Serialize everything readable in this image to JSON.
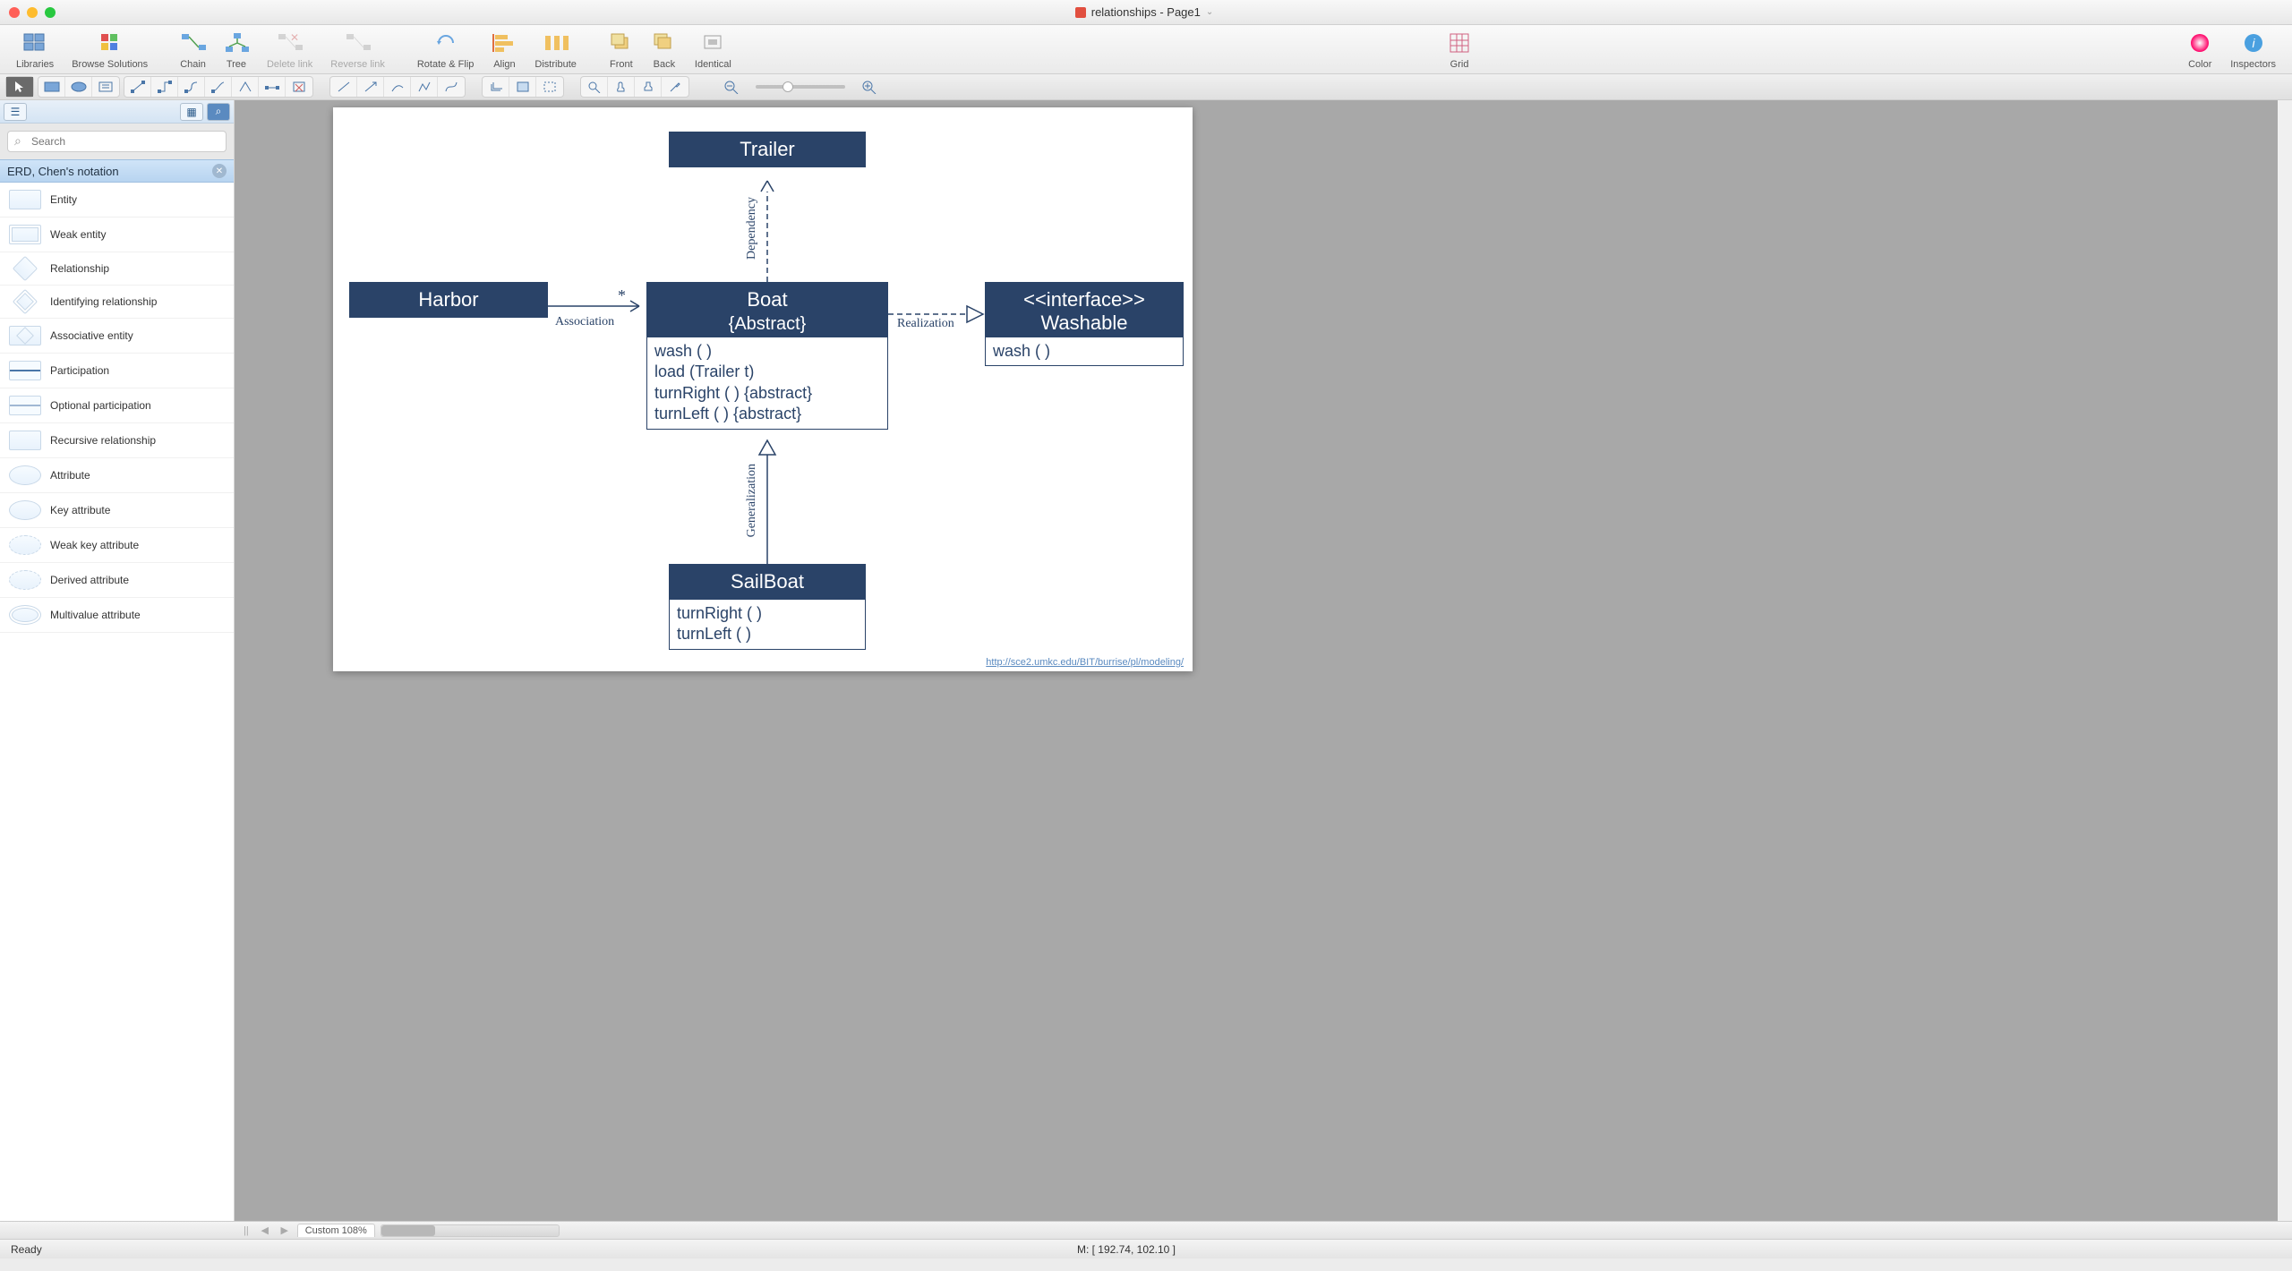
{
  "window": {
    "title": "relationships - Page1"
  },
  "toolbar": {
    "items": [
      {
        "label": "Libraries",
        "id": "libraries"
      },
      {
        "label": "Browse Solutions",
        "id": "browse-solutions"
      },
      {
        "label": "Chain",
        "id": "chain"
      },
      {
        "label": "Tree",
        "id": "tree"
      },
      {
        "label": "Delete link",
        "id": "delete-link",
        "disabled": true
      },
      {
        "label": "Reverse link",
        "id": "reverse-link",
        "disabled": true
      },
      {
        "label": "Rotate & Flip",
        "id": "rotate-flip"
      },
      {
        "label": "Align",
        "id": "align"
      },
      {
        "label": "Distribute",
        "id": "distribute"
      },
      {
        "label": "Front",
        "id": "front"
      },
      {
        "label": "Back",
        "id": "back"
      },
      {
        "label": "Identical",
        "id": "identical"
      },
      {
        "label": "Grid",
        "id": "grid"
      },
      {
        "label": "Color",
        "id": "color"
      },
      {
        "label": "Inspectors",
        "id": "inspectors"
      }
    ]
  },
  "sidebar": {
    "search_placeholder": "Search",
    "section_title": "ERD, Chen's notation",
    "items": [
      {
        "label": "Entity"
      },
      {
        "label": "Weak entity"
      },
      {
        "label": "Relationship"
      },
      {
        "label": "Identifying relationship"
      },
      {
        "label": "Associative entity"
      },
      {
        "label": "Participation"
      },
      {
        "label": "Optional participation"
      },
      {
        "label": "Recursive relationship"
      },
      {
        "label": "Attribute"
      },
      {
        "label": "Key attribute"
      },
      {
        "label": "Weak key attribute"
      },
      {
        "label": "Derived attribute"
      },
      {
        "label": "Multivalue attribute"
      }
    ]
  },
  "diagram": {
    "trailer": {
      "title": "Trailer"
    },
    "harbor": {
      "title": "Harbor"
    },
    "boat": {
      "title": "Boat",
      "subtitle": "{Abstract}",
      "methods": [
        "wash ( )",
        "load (Trailer t)",
        "turnRight ( ) {abstract}",
        "turnLeft ( ) {abstract}"
      ]
    },
    "washable": {
      "stereotype": "<<interface>>",
      "title": "Washable",
      "methods": [
        "wash ( )"
      ]
    },
    "sailboat": {
      "title": "SailBoat",
      "methods": [
        "turnRight ( )",
        "turnLeft ( )"
      ]
    },
    "labels": {
      "association": "Association",
      "dependency": "Dependency",
      "realization": "Realization",
      "generalization": "Generalization",
      "mult_star": "*"
    },
    "url": "http://sce2.umkc.edu/BIT/burrise/pl/modeling/"
  },
  "tabbar": {
    "zoom_label": "Custom 108%"
  },
  "status": {
    "ready": "Ready",
    "mouse": "M: [ 192.74, 102.10 ]"
  }
}
